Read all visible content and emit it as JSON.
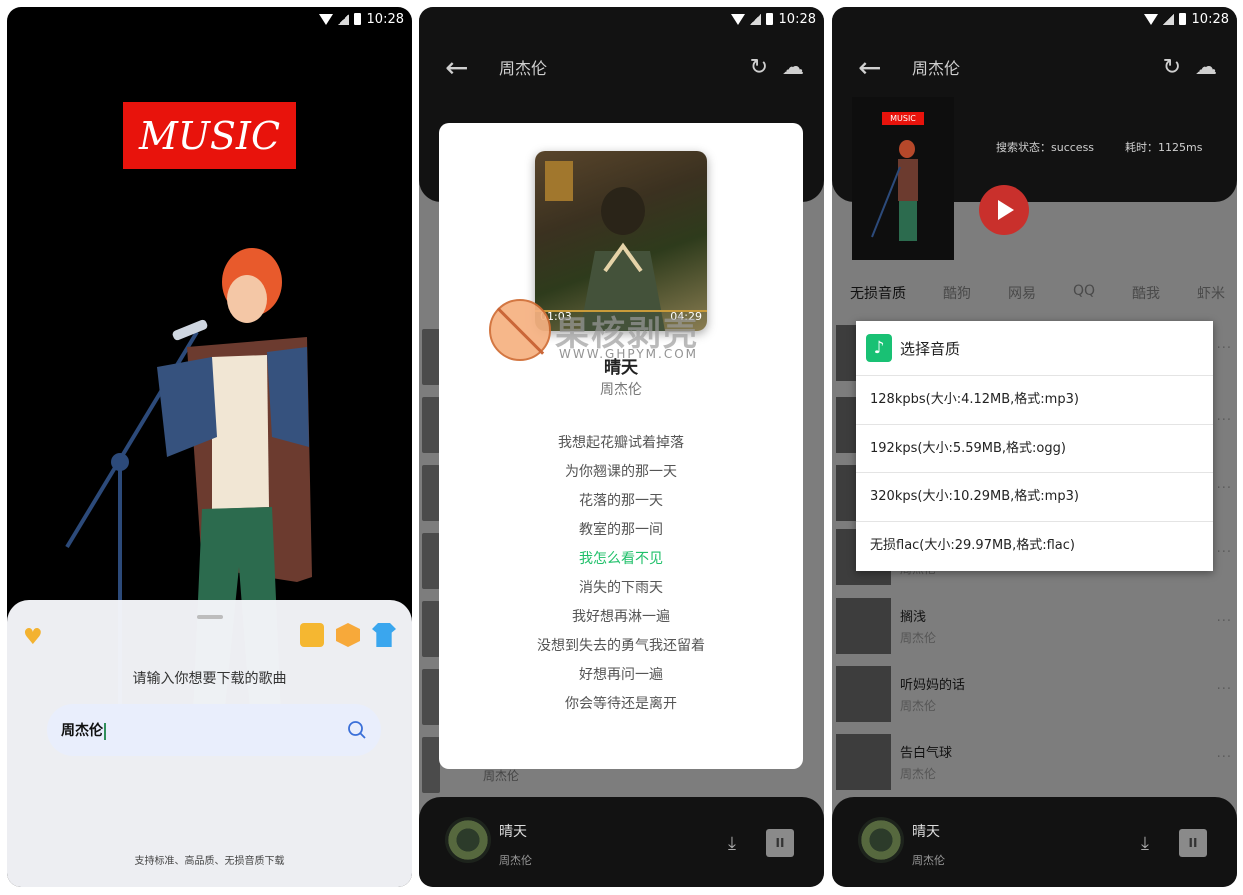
{
  "status_bar": {
    "time": "10:28"
  },
  "screen1": {
    "logo_text": "MUSIC",
    "prompt": "请输入你想要下载的歌曲",
    "search": {
      "value": "周杰伦"
    },
    "footnote": "支持标准、高品质、无损音质下载"
  },
  "screen2": {
    "header_title": "周杰伦",
    "song": {
      "title": "晴天",
      "artist": "周杰伦",
      "elapsed": "01:03",
      "duration": "04:29"
    },
    "lyrics": [
      "我想起花瓣试着掉落",
      "为你翘课的那一天",
      "花落的那一天",
      "教室的那一间",
      "我怎么看不见",
      "消失的下雨天",
      "我好想再淋一遍",
      "没想到失去的勇气我还留着",
      "好想再问一遍",
      "你会等待还是离开"
    ],
    "active_lyric_index": 4,
    "list_artist": "周杰伦",
    "player": {
      "title": "晴天",
      "artist": "周杰伦"
    },
    "watermark": {
      "text": "果核剥壳",
      "url": "WWW.GHPYM.COM"
    }
  },
  "screen3": {
    "header_title": "周杰伦",
    "mini_logo": "MUSIC",
    "search_status": "搜索状态：success",
    "elapsed": "耗时：1125ms",
    "tabs": [
      "无损音质",
      "酷狗",
      "网易",
      "QQ",
      "酷我",
      "虾米"
    ],
    "dialog": {
      "title": "选择音质",
      "options": [
        "128kpbs(大小:4.12MB,格式:mp3)",
        "192kps(大小:5.59MB,格式:ogg)",
        "320kps(大小:10.29MB,格式:mp3)",
        "无损flac(大小:29.97MB,格式:flac)"
      ]
    },
    "songs": [
      {
        "title": "",
        "artist": "周杰伦"
      },
      {
        "title": "搁浅",
        "artist": "周杰伦"
      },
      {
        "title": "听妈妈的话",
        "artist": "周杰伦"
      },
      {
        "title": "告白气球",
        "artist": "周杰伦"
      }
    ],
    "player": {
      "title": "晴天",
      "artist": "周杰伦"
    }
  },
  "colors": {
    "accent_green": "#20c06a",
    "brand_red": "#e8130c",
    "play_red": "#c9302c"
  }
}
